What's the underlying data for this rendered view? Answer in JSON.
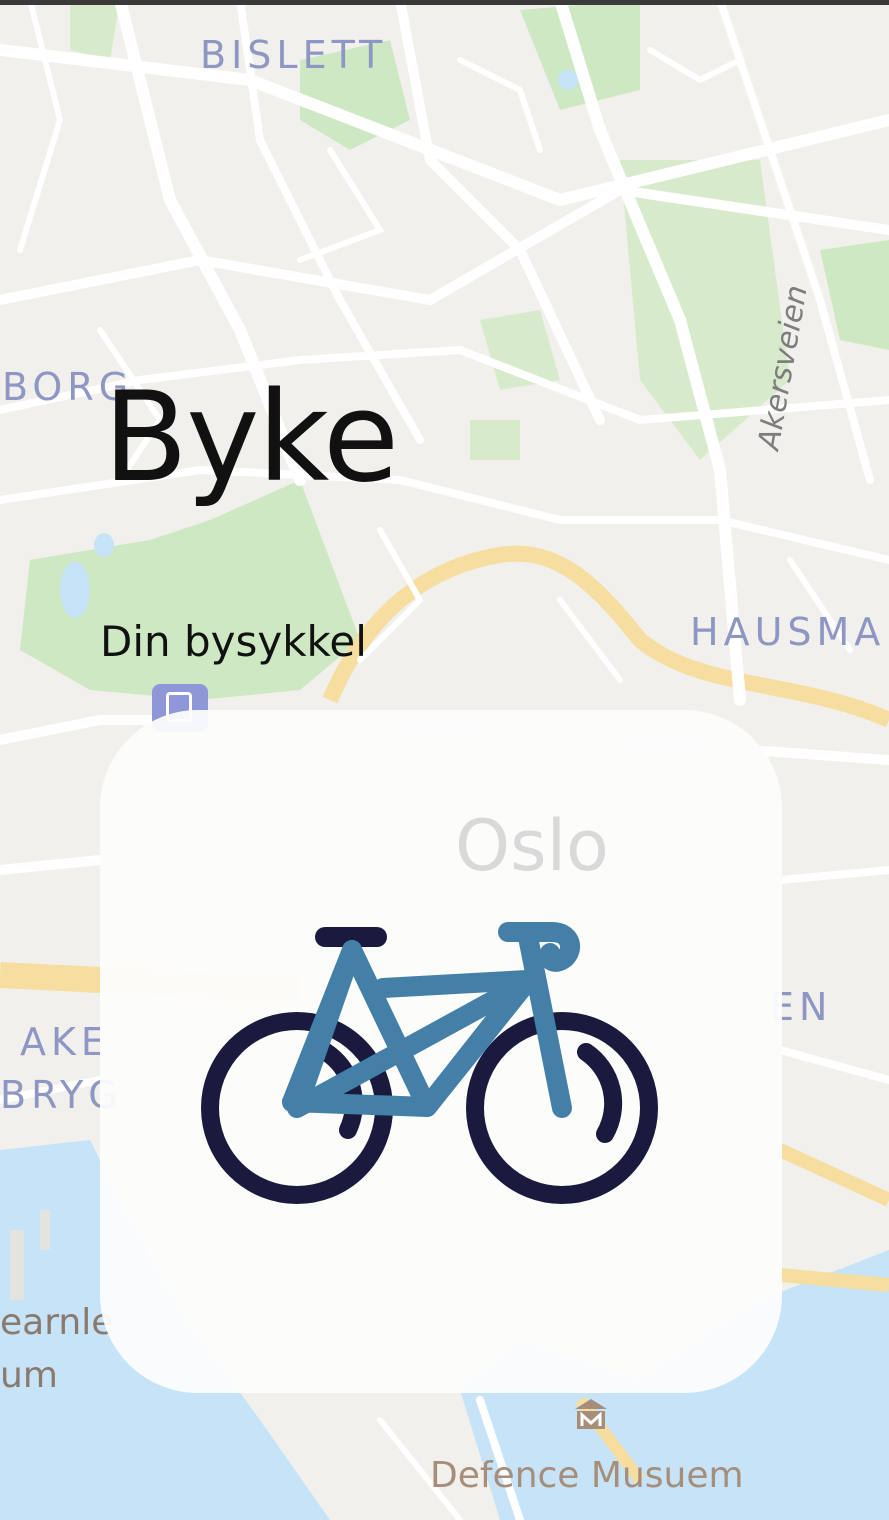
{
  "app": {
    "title": "Byke",
    "subtitle": "Din bysykkel"
  },
  "map": {
    "districts": {
      "bislett": "BISLETT",
      "borg": "BORG",
      "hausmann": "HAUSMA",
      "aker_line1": "AKE",
      "aker_line2": "BRYG",
      "behind_card_1": "Oslo",
      "behind_card_2": "EN"
    },
    "streets": {
      "akersveien": "Akersveien"
    },
    "pois": {
      "museum_partial_1": "earnle",
      "museum_partial_2": "um",
      "defence_museum": "Defence Musuem"
    },
    "icons": {
      "station": "transit-station-icon",
      "museum": "museum-icon"
    }
  },
  "card": {
    "icon": "bicycle-icon"
  },
  "colors": {
    "map_land": "#f2f0ec",
    "map_water": "#c6e3f7",
    "map_park": "#cfe8c4",
    "map_road": "#ffffff",
    "map_major_road": "#f6dea0",
    "district_label": "#8e97c4",
    "bike_frame": "#447fa8",
    "bike_wheels": "#1a1a3e",
    "card_background": "#fcfcfc"
  }
}
